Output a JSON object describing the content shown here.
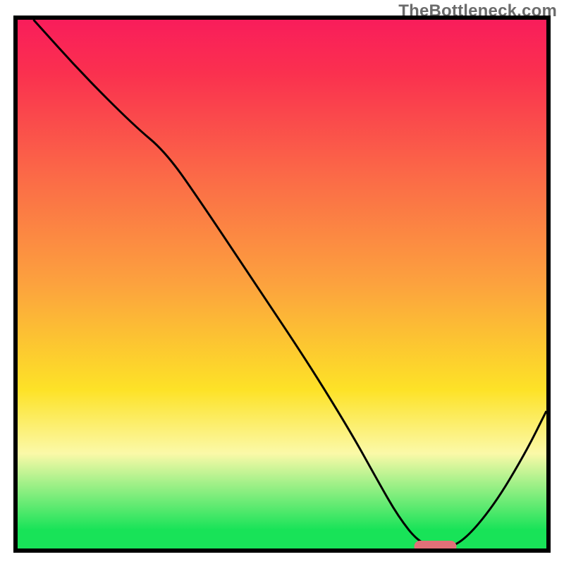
{
  "watermark": "TheBottleneck.com",
  "colors": {
    "frame": "#000000",
    "curve": "#000000",
    "marker_fill": "#e27078",
    "green": "#18e358",
    "yellow_pale": "#fbf9a8",
    "yellow": "#fde227",
    "orange": "#fca23e",
    "red_orange": "#fb6b47",
    "red": "#fa304f",
    "magenta": "#f91d5b"
  },
  "chart_data": {
    "type": "line",
    "title": "",
    "xlabel": "",
    "ylabel": "",
    "xlim": [
      0,
      100
    ],
    "ylim": [
      0,
      100
    ],
    "x": [
      3,
      12,
      22,
      28,
      35,
      45,
      55,
      63,
      68,
      72,
      76,
      80,
      84,
      90,
      96,
      100
    ],
    "values": [
      100,
      90,
      80,
      75,
      65,
      50,
      35,
      22,
      13,
      6,
      1,
      0,
      1,
      8,
      18,
      26
    ],
    "marker": {
      "x_start": 75,
      "x_end": 83,
      "y": 0
    },
    "gradient_stops": [
      {
        "offset": 0.0,
        "key": "magenta"
      },
      {
        "offset": 0.1,
        "key": "red"
      },
      {
        "offset": 0.3,
        "key": "red_orange"
      },
      {
        "offset": 0.5,
        "key": "orange"
      },
      {
        "offset": 0.7,
        "key": "yellow"
      },
      {
        "offset": 0.82,
        "key": "yellow_pale"
      },
      {
        "offset": 0.965,
        "key": "green"
      },
      {
        "offset": 1.0,
        "key": "green"
      }
    ]
  }
}
